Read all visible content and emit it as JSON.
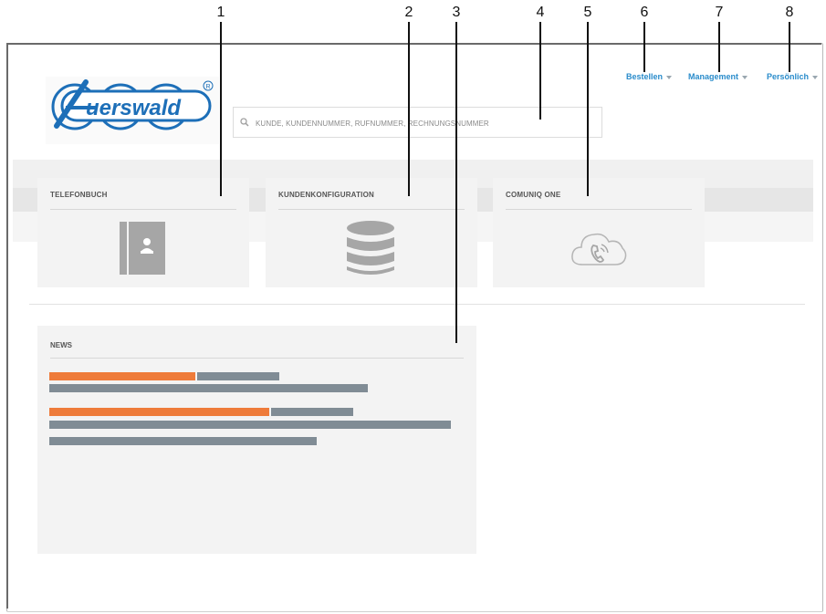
{
  "callouts": [
    "1",
    "2",
    "3",
    "4",
    "5",
    "6",
    "7",
    "8"
  ],
  "header": {
    "logo_text": "Auerswald",
    "search": {
      "placeholder": "KUNDE, KUNDENNUMMER, RUFNUMMER, RECHNUNGSNUMMER"
    },
    "nav": [
      {
        "label": "Bestellen"
      },
      {
        "label": "Management"
      },
      {
        "label": "Persönlich"
      }
    ]
  },
  "tiles": [
    {
      "title": "TELEFONBUCH",
      "icon": "contact-book-icon"
    },
    {
      "title": "KUNDENKONFIGURATION",
      "icon": "database-icon"
    },
    {
      "title": "COMUNIQ ONE",
      "icon": "cloud-phone-icon"
    }
  ],
  "news": {
    "title": "NEWS"
  },
  "colors": {
    "accent": "#2a8ccb",
    "news_highlight": "#ee7b3a",
    "news_text_placeholder": "#808c95",
    "logo_blue": "#1d6fb8"
  }
}
